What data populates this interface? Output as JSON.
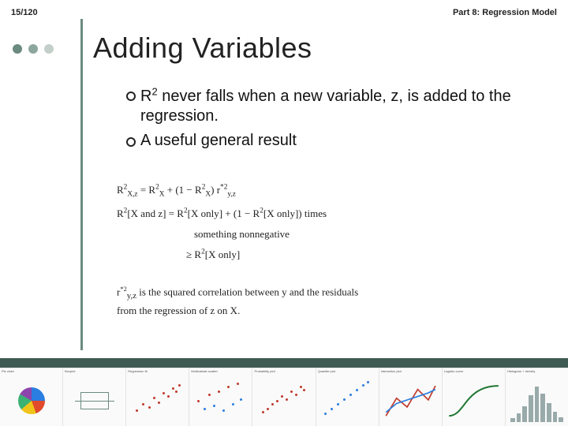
{
  "header": {
    "page": "15/120",
    "part": "Part 8: Regression Model"
  },
  "title": "Adding Variables",
  "bullets": [
    {
      "pre": "R",
      "sup": "2",
      "post": " never falls when a new variable, z, is added to the regression."
    },
    {
      "text": "A useful general result"
    }
  ],
  "math": {
    "line1": {
      "pre": "R",
      "sup1": "2",
      "sub1": "X,z",
      "mid": " = R",
      "sup2": "2",
      "sub2": "X",
      "mid2": " + (1 − R",
      "sup3": "2",
      "sub3": "X",
      "post": ") r",
      "starsup": "*2",
      "starsub": "y,z"
    },
    "line2": {
      "lhs": "R",
      "lsup": "2",
      "lbr": "[X and z]",
      "eq": "  =  ",
      "rhs1": "R",
      "rsup1": "2",
      "rbr1": "[X only] + (1 − R",
      "rsup2": "2",
      "rbr2": "[X only]) times"
    },
    "line2b": "something nonnegative",
    "line3": {
      "geq": "≥  ",
      "r": "R",
      "sup": "2",
      "br": "[X only]"
    }
  },
  "note": {
    "line1": {
      "pre": "r",
      "sup": "*2",
      "sub": "y,z",
      "post": " is the squared correlation between y and the residuals"
    },
    "line2": "from the regression of z on X."
  },
  "thumbs": [
    "Pie chart",
    "Boxplot",
    "Regression fit",
    "Multivariate scatter",
    "Probability plot",
    "Quantile plot",
    "Interaction plot",
    "Logistic curve",
    "Histogram + density"
  ]
}
